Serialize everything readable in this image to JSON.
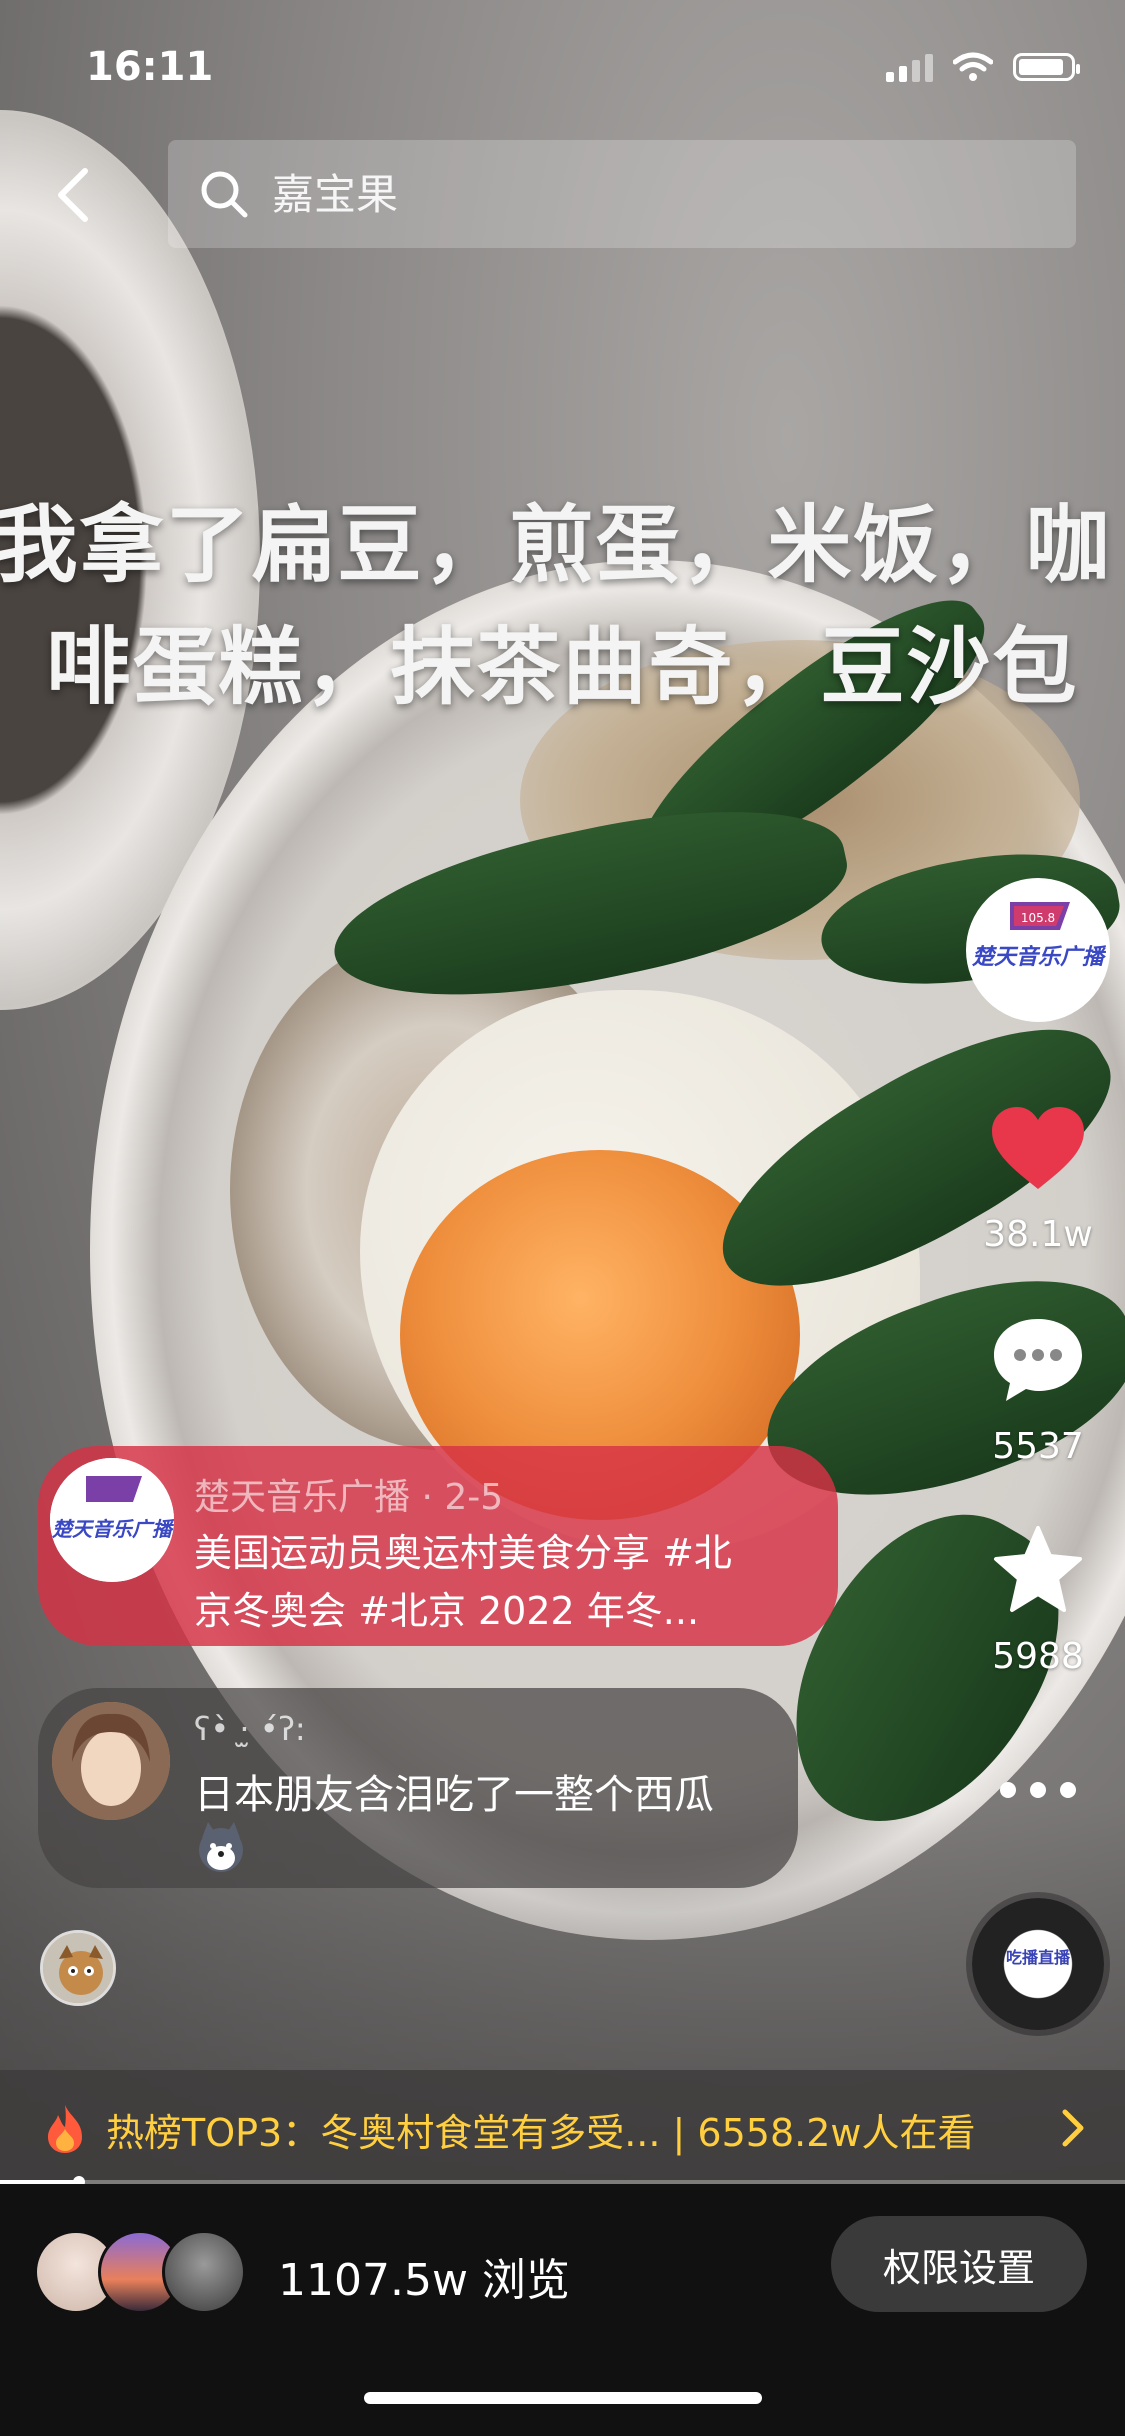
{
  "status_bar": {
    "time": "16:11"
  },
  "search": {
    "placeholder": "嘉宝果"
  },
  "caption": {
    "line1": "我拿了扁豆，煎蛋，米饭，咖",
    "line2": "啡蛋糕，抹茶曲奇，豆沙包"
  },
  "author": {
    "logo_text": "楚天音乐广播",
    "logo_badge": "105.8"
  },
  "actions": {
    "like_count": "38.1w",
    "comment_count": "5537",
    "favorite_count": "5988"
  },
  "source_card": {
    "meta": "楚天音乐广播 · 2-5",
    "desc_line1": "美国运动员奥运村美食分享 #北",
    "desc_line2": "京冬奥会 #北京 2022 年冬..."
  },
  "comment_card": {
    "user": "ʕ•̀ ·̫ •́ʔ:",
    "text": "日本朋友含泪吃了一整个西瓜"
  },
  "music": {
    "disc_label": "吃播直播"
  },
  "hot_bar": {
    "text": "热榜TOP3：冬奥村食堂有多受...  | 6558.2w人在看"
  },
  "playback": {
    "progress_percent": 7
  },
  "bottom": {
    "views": "1107.5w 浏览",
    "permission_button": "权限设置"
  },
  "colors": {
    "like": "#e8364b",
    "hot_text": "#ffcf3f",
    "card_red": "#d73246"
  }
}
